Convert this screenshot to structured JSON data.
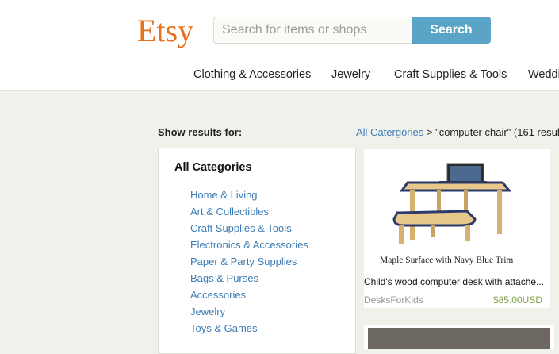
{
  "header": {
    "logo": "Etsy",
    "search_placeholder": "Search for items or shops",
    "search_button": "Search"
  },
  "nav": {
    "items": [
      "Clothing & Accessories",
      "Jewelry",
      "Craft Supplies & Tools",
      "Weddi"
    ]
  },
  "sidebar": {
    "show_results_label": "Show results for:",
    "title": "All Categories",
    "categories": [
      "Home & Living",
      "Art & Collectibles",
      "Craft Supplies & Tools",
      "Electronics & Accessories",
      "Paper & Party Supplies",
      "Bags & Purses",
      "Accessories",
      "Jewelry",
      "Toys & Games"
    ]
  },
  "breadcrumb": {
    "link": "All Catergories",
    "rest": " > \"computer chair\" (161 resul"
  },
  "results": [
    {
      "image_caption": "Maple Surface with Navy Blue Trim",
      "title": "Child's wood computer desk with attache...",
      "shop": "DesksForKids",
      "price": "$85.00USD"
    }
  ],
  "colors": {
    "brand": "#e8711c",
    "link": "#3d7cb6",
    "search_button": "#5aa5c7",
    "price": "#7aa045",
    "background": "#f1f1ec"
  }
}
